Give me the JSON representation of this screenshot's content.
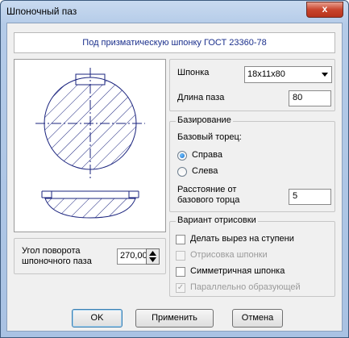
{
  "window": {
    "title": "Шпоночный паз",
    "close_glyph": "x"
  },
  "header": {
    "text": "Под призматическую шпонку ГОСТ 23360-78"
  },
  "rotation": {
    "label": "Угол поворота шпоночного паза",
    "value": "270,00"
  },
  "key": {
    "key_label": "Шпонка",
    "key_value": "18x11x80",
    "length_label": "Длина паза",
    "length_value": "80"
  },
  "basing": {
    "legend": "Базирование",
    "face_label": "Базовый торец:",
    "right_label": "Справа",
    "left_label": "Слева",
    "selected": "right",
    "distance_label": "Расстояние от базового торца",
    "distance_value": "5"
  },
  "drawing_options": {
    "legend": "Вариант отрисовки",
    "options": [
      {
        "label": "Делать вырез на ступени",
        "checked": false,
        "enabled": true
      },
      {
        "label": "Отрисовка шпонки",
        "checked": false,
        "enabled": false
      },
      {
        "label": "Симметричная шпонка",
        "checked": false,
        "enabled": true
      },
      {
        "label": "Параллельно образующей",
        "checked": true,
        "enabled": false
      }
    ]
  },
  "buttons": {
    "ok": "OK",
    "apply": "Применить",
    "cancel": "Отмена"
  },
  "colors": {
    "drawing_line": "#1a237e",
    "header_text": "#1a2f8c",
    "close_button": "#c8452d"
  }
}
